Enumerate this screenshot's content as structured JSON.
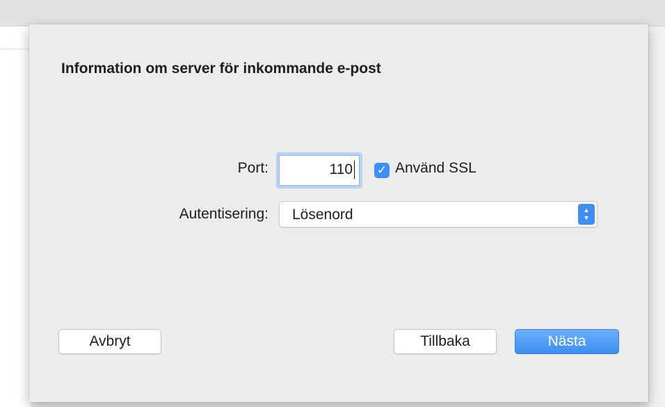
{
  "dialog": {
    "title": "Information om server för inkommande e-post",
    "port": {
      "label": "Port:",
      "value": "110"
    },
    "ssl": {
      "label": "Använd SSL",
      "checked": true
    },
    "authentication": {
      "label": "Autentisering:",
      "selected": "Lösenord"
    },
    "buttons": {
      "cancel": "Avbryt",
      "back": "Tillbaka",
      "next": "Nästa"
    }
  },
  "colors": {
    "accent": "#3e8ef3",
    "sheet_background": "#ececec"
  },
  "icons": {
    "checkbox": "checkmark-icon",
    "select": "up-down-chevron-icon"
  }
}
